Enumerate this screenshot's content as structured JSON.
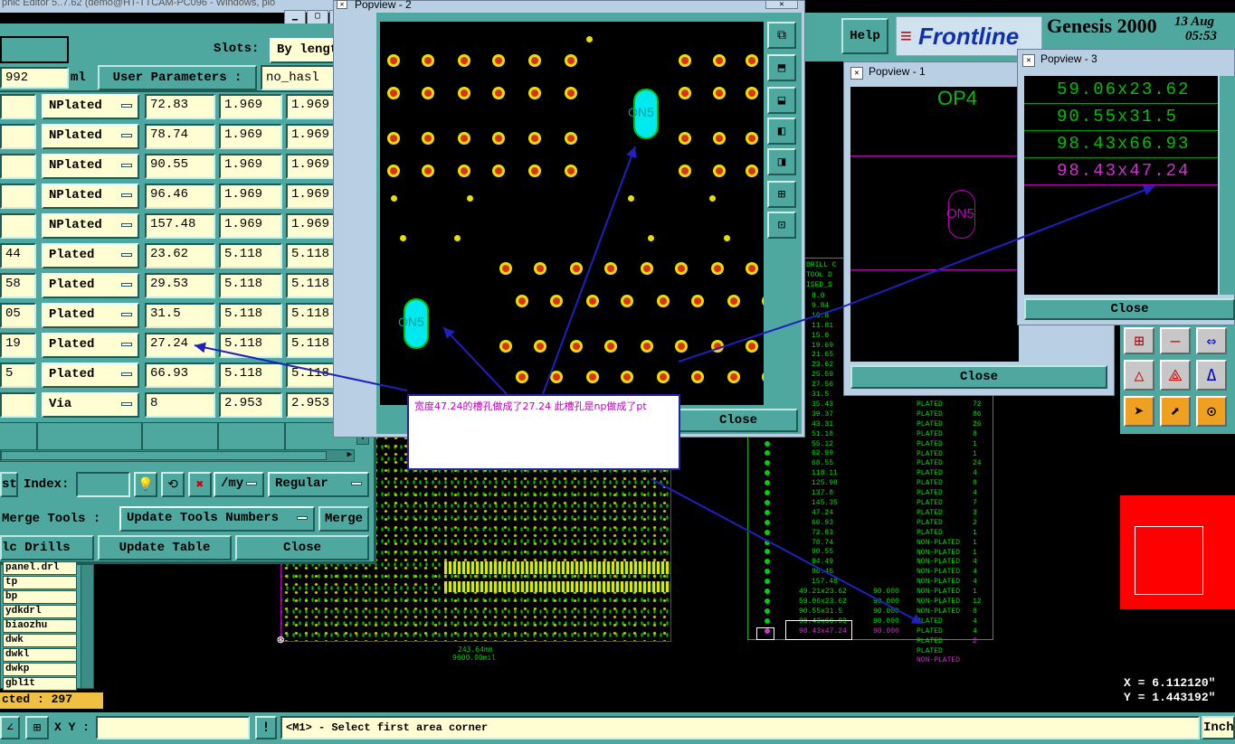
{
  "app": {
    "title_fragment": "phic Editor 5..7.62 (demo@HT-TTCAM-PC096 - Windows, plo",
    "help": "Help",
    "brand": "Frontline",
    "product": "Genesis 2000",
    "date": "13 Aug",
    "time": "05:53"
  },
  "toolmgr": {
    "slots_label": "Slots:",
    "slots_value": "By length",
    "num_value": "992",
    "ml_label": "ml",
    "user_params_label": "User Parameters :",
    "user_params_value": "no_hasl",
    "rows": [
      {
        "num": "",
        "type": "NPlated",
        "size": "72.83",
        "min": "1.969",
        "max": "1.969"
      },
      {
        "num": "",
        "type": "NPlated",
        "size": "78.74",
        "min": "1.969",
        "max": "1.969"
      },
      {
        "num": "",
        "type": "NPlated",
        "size": "90.55",
        "min": "1.969",
        "max": "1.969"
      },
      {
        "num": "",
        "type": "NPlated",
        "size": "96.46",
        "min": "1.969",
        "max": "1.969"
      },
      {
        "num": "",
        "type": "NPlated",
        "size": "157.48",
        "min": "1.969",
        "max": "1.969"
      },
      {
        "num": "44",
        "type": "Plated",
        "size": "23.62",
        "min": "5.118",
        "max": "5.118"
      },
      {
        "num": "58",
        "type": "Plated",
        "size": "29.53",
        "min": "5.118",
        "max": "5.118"
      },
      {
        "num": "05",
        "type": "Plated",
        "size": "31.5",
        "min": "5.118",
        "max": "5.118"
      },
      {
        "num": "19",
        "type": "Plated",
        "size": "27.24",
        "min": "5.118",
        "max": "5.118"
      },
      {
        "num": "5",
        "type": "Plated",
        "size": "66.93",
        "min": "5.118",
        "max": "5.118"
      },
      {
        "num": "",
        "type": "Via",
        "size": "8",
        "min": "2.953",
        "max": "2.953"
      }
    ],
    "st_label": "st",
    "index_label": "Index:",
    "my_label": "/my",
    "regular_label": "Regular",
    "merge_tools_label": "Merge Tools :",
    "update_tools_numbers": "Update Tools Numbers",
    "merge_button": "Merge",
    "calc_drills": "lc Drills",
    "update_table": "Update Table",
    "close": "Close"
  },
  "layers": {
    "items": [
      "panel.drl",
      "tp",
      "bp",
      "ydkdrl",
      "biaozhu",
      "dwk",
      "dwkl",
      "dwkp",
      "gbl1t"
    ],
    "selected_status": "cted : 297"
  },
  "popview2": {
    "title": "Popview - 2",
    "close": "Close",
    "slot_label": "ON5"
  },
  "popview1": {
    "title": "Popview - 1",
    "label_top": "OP4",
    "label_mid": "ON5",
    "close": "Close"
  },
  "popview3": {
    "title": "Popview - 3",
    "lines": [
      "59.06x23.62",
      "90.55x31.5",
      "98.43x66.93",
      "98.43x47.24"
    ],
    "close": "Close"
  },
  "annotation": {
    "text": "宽度47.24的槽孔做成了27.24 此槽孔是np做成了pt"
  },
  "board": {
    "dim_mm": "243.64mm",
    "dim_mil": "9600.00mil"
  },
  "drill_table": {
    "header": [
      "DRILL C",
      "TOOL D",
      "ISED_S"
    ],
    "sizes": [
      "8.0",
      "9.84",
      "10.8",
      "11.81",
      "15.0",
      "19.69",
      "21.65",
      "23.62",
      "25.59",
      "27.56",
      "31.5",
      "35.43",
      "39.37",
      "43.31",
      "51.18",
      "55.12",
      "62.99",
      "68.55",
      "118.11",
      "125.98",
      "137.8",
      "145.35",
      "47.24",
      "66.93",
      "72.83",
      "78.74",
      "90.55",
      "94.49",
      "96.46",
      "157.48",
      "49.21x23.62",
      "59.06x23.62",
      "90.55x31.5",
      "98.43x66.93",
      "98.43x47.24"
    ],
    "slot_len": "90.000",
    "types": [
      "PLATED",
      "PLATED",
      "PLATED",
      "PLATED",
      "PLATED",
      "PLATED",
      "PLATED",
      "PLATED",
      "PLATED",
      "PLATED",
      "PLATED",
      "PLATED",
      "PLATED",
      "PLATED",
      "NON-PLATED",
      "NON-PLATED",
      "NON-PLATED",
      "NON-PLATED",
      "NON-PLATED",
      "NON-PLATED",
      "NON-PLATED",
      "NON-PLATED",
      "PLATED",
      "PLATED",
      "PLATED",
      "PLATED",
      "NON-PLATED"
    ],
    "counts": [
      "72",
      "86",
      "26",
      "8",
      "1",
      "1",
      "24",
      "4",
      "8",
      "4",
      "7",
      "3",
      "2",
      "1",
      "1",
      "1",
      "4",
      "4",
      "4",
      "1",
      "12",
      "8",
      "4",
      "4",
      "2"
    ]
  },
  "coords": {
    "x": "X = 6.112120\"",
    "y": "Y = 1.443192\""
  },
  "statusbar": {
    "xy_label": "X Y :",
    "message": "<M1> - Select first area corner",
    "units": "Inch"
  }
}
